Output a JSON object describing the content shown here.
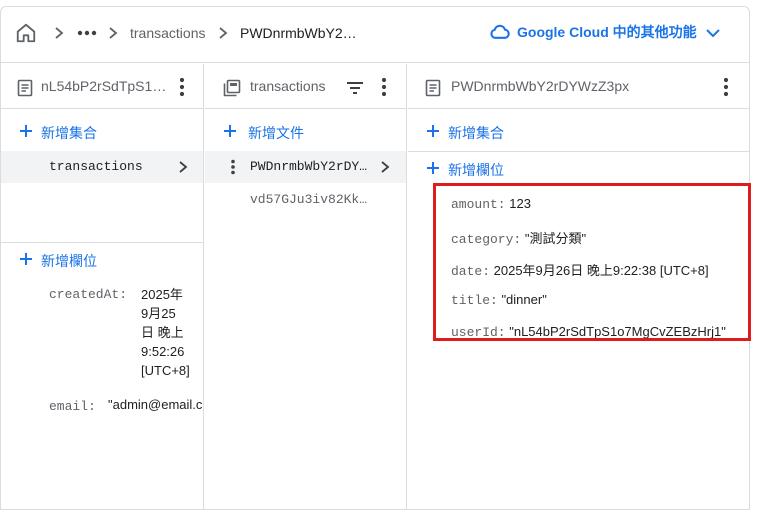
{
  "breadcrumb": {
    "collection": "transactions",
    "document": "PWDnrmbWbY2…"
  },
  "header_link": {
    "label": "Google Cloud 中的其他功能"
  },
  "col1": {
    "title": "nL54bP2rSdTpS1o…",
    "add_collection": "新增集合",
    "items": [
      "transactions"
    ],
    "add_field": "新增欄位",
    "fields": {
      "createdAt_key": "createdAt:",
      "createdAt_line1": "2025年",
      "createdAt_line2": "9月25",
      "createdAt_line3": "日 晚上",
      "createdAt_line4": "9:52:26",
      "createdAt_line5": "[UTC+8]",
      "email_key": "email:",
      "email_val": "\"admin@email.c"
    }
  },
  "col2": {
    "title": "transactions",
    "add_document": "新增文件",
    "docs": [
      "PWDnrmbWbY2rDY…",
      "vd57GJu3iv82Kk…"
    ]
  },
  "col3": {
    "title": "PWDnrmbWbY2rDYWzZ3px",
    "add_collection": "新增集合",
    "add_field": "新增欄位",
    "fields": [
      {
        "key": "amount:",
        "value": "123"
      },
      {
        "key": "category:",
        "value": "\"測試分類\""
      },
      {
        "key": "date:",
        "value": "2025年9月26日 晚上9:22:38 [UTC+8]"
      },
      {
        "key": "title:",
        "value": "\"dinner\""
      },
      {
        "key": "userId:",
        "value": "\"nL54bP2rSdTpS1o7MgCvZEBzHrj1\""
      }
    ]
  },
  "colors": {
    "accent": "#1a73e8",
    "highlight": "#e01b1b",
    "selected_bg": "#f1f3f4",
    "border": "#dadce0"
  }
}
